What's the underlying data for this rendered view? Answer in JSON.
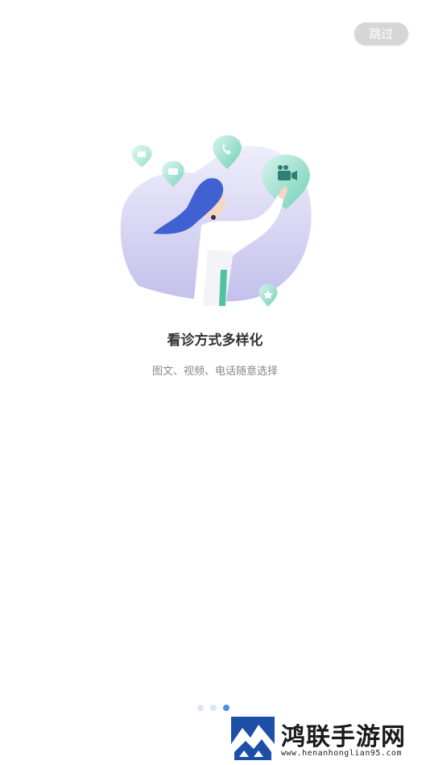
{
  "header": {
    "skip_label": "跳过"
  },
  "onboarding": {
    "title": "看诊方式多样化",
    "subtitle": "图文、视频、电话随意选择"
  },
  "pager": {
    "count": 3,
    "active_index": 2
  },
  "watermark": {
    "title": "鸿联手游网",
    "url": "www.henanhonglian95.com"
  },
  "colors": {
    "accent": "#4e8fe6",
    "teal": "#5cc8ac",
    "lavender": "#cbc9ef",
    "hair_blue": "#3f61d2"
  }
}
